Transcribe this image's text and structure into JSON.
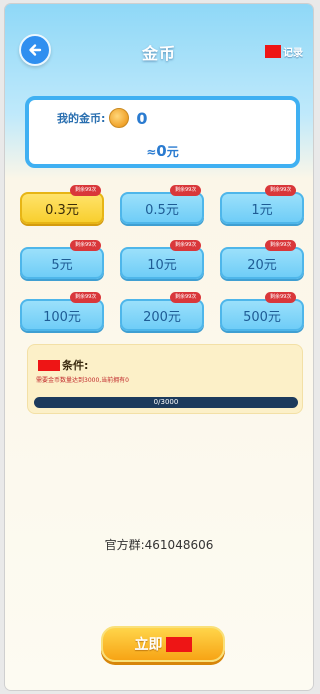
{
  "header": {
    "title": "金币",
    "record_label": "记录"
  },
  "coins": {
    "label": "我的金币:",
    "value": "0",
    "approx_prefix": "≈",
    "approx_amount": "0",
    "approx_unit": "元"
  },
  "amounts": [
    {
      "label": "0.3元",
      "tag": "剩余99次",
      "selected": true
    },
    {
      "label": "0.5元",
      "tag": "剩余99次",
      "selected": false
    },
    {
      "label": "1元",
      "tag": "剩余99次",
      "selected": false
    },
    {
      "label": "5元",
      "tag": "剩余99次",
      "selected": false
    },
    {
      "label": "10元",
      "tag": "剩余99次",
      "selected": false
    },
    {
      "label": "20元",
      "tag": "剩余99次",
      "selected": false
    },
    {
      "label": "100元",
      "tag": "剩余99次",
      "selected": false
    },
    {
      "label": "200元",
      "tag": "剩余99次",
      "selected": false
    },
    {
      "label": "500元",
      "tag": "剩余99次",
      "selected": false
    }
  ],
  "condition": {
    "title": "条件:",
    "text": "需要金币数量达到3000,当前拥有0",
    "progress_text": "0/3000",
    "progress_fraction": 0
  },
  "group_text": "官方群:461048606",
  "cta_label": "立即"
}
